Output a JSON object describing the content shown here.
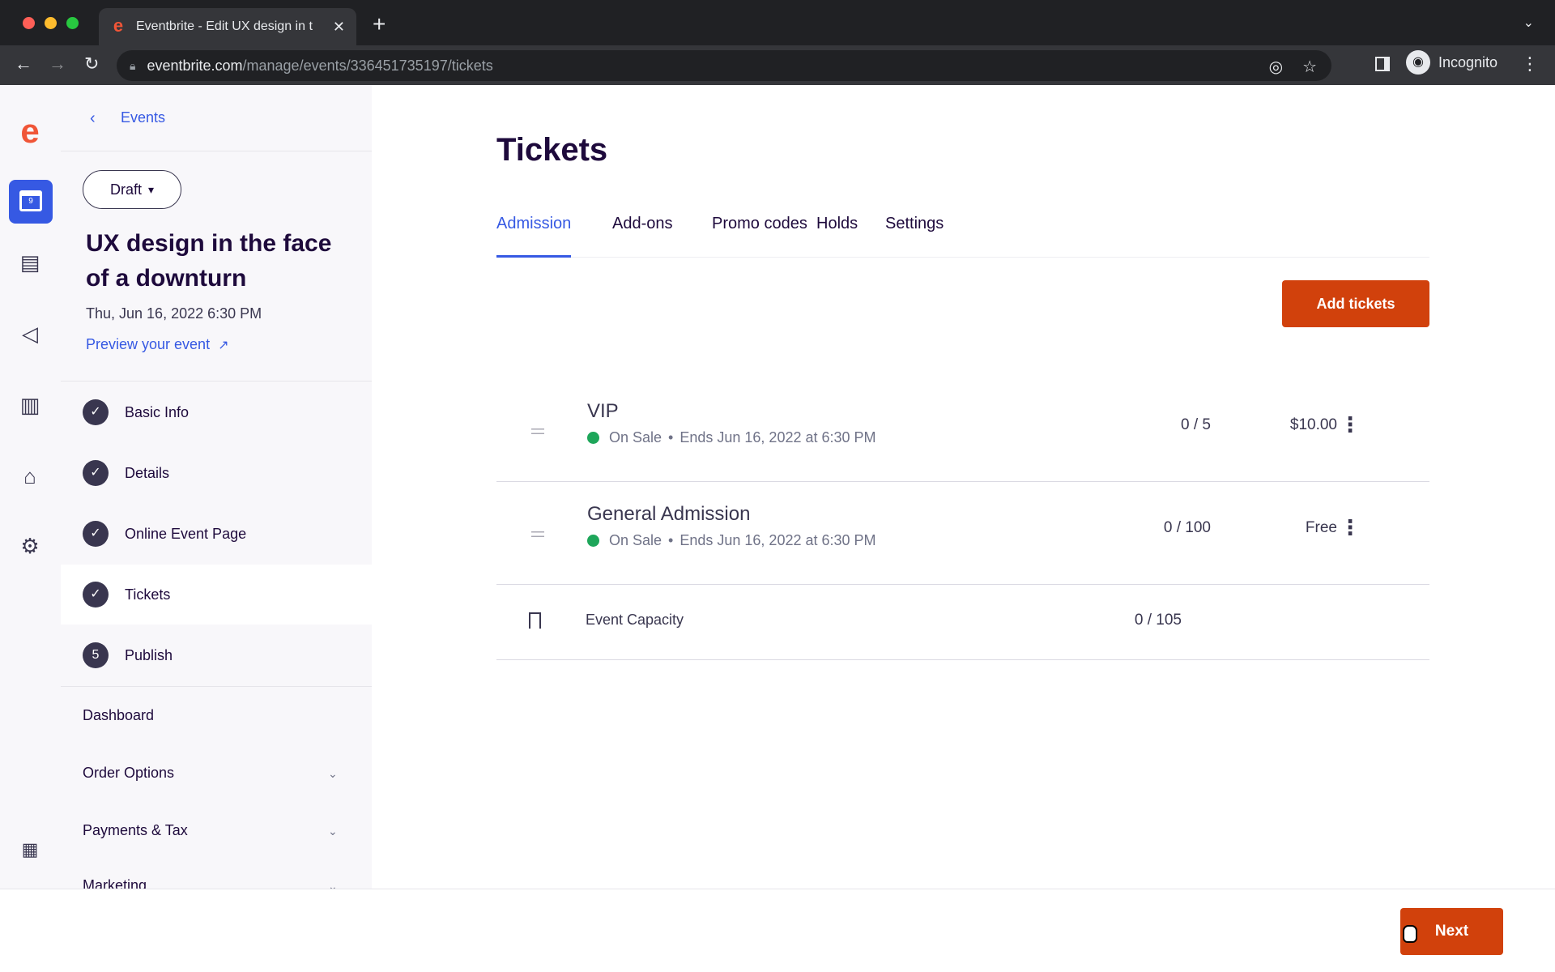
{
  "browser": {
    "tab_title": "Eventbrite - Edit UX design in t",
    "url_host": "eventbrite.com",
    "url_path": "/manage/events/336451735197/tickets",
    "profile_label": "Incognito"
  },
  "rail": {
    "calendar_day": "9"
  },
  "sidebar": {
    "back_label": "Events",
    "status": "Draft",
    "event_title": "UX design in the face of a downturn",
    "event_date": "Thu, Jun 16, 2022 6:30 PM",
    "preview_label": "Preview your event",
    "steps": [
      {
        "label": "Basic Info",
        "marker": "✓"
      },
      {
        "label": "Details",
        "marker": "✓"
      },
      {
        "label": "Online Event Page",
        "marker": "✓"
      },
      {
        "label": "Tickets",
        "marker": "✓"
      },
      {
        "label": "Publish",
        "marker": "5"
      }
    ],
    "dashboard_label": "Dashboard",
    "groups": [
      "Order Options",
      "Payments & Tax",
      "Marketing"
    ]
  },
  "main": {
    "title": "Tickets",
    "tabs": [
      "Admission",
      "Add-ons",
      "Promo codes",
      "Holds",
      "Settings"
    ],
    "add_tickets_label": "Add tickets",
    "tickets": [
      {
        "name": "VIP",
        "status": "On Sale",
        "ends": "Ends Jun 16, 2022 at 6:30 PM",
        "sold": "0 / 5",
        "price": "$10.00"
      },
      {
        "name": "General Admission",
        "status": "On Sale",
        "ends": "Ends Jun 16, 2022 at 6:30 PM",
        "sold": "0 / 100",
        "price": "Free"
      }
    ],
    "capacity_label": "Event Capacity",
    "capacity_value": "0 / 105"
  },
  "footer": {
    "next_label": "Next"
  },
  "colors": {
    "brand": "#f05537",
    "primary_blue": "#3659e3",
    "cta": "#d1410c",
    "on_sale": "#1ea65a"
  }
}
